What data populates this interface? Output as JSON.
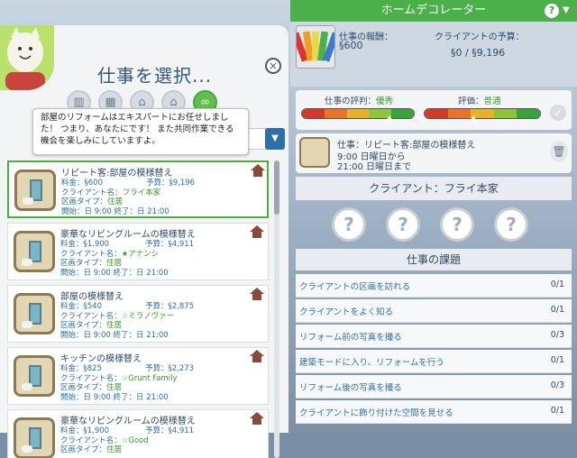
{
  "left": {
    "title": "仕事を選択...",
    "close": "×",
    "tooltip": "部屋のリフォームはエキスパートにお任せしました！ つまり、あなたにです！ また共同作業できる機会を楽しみにしていますよ。",
    "filters": [
      {
        "icon": "building-icon"
      },
      {
        "icon": "building-icon"
      },
      {
        "icon": "house-icon"
      },
      {
        "icon": "house-icon"
      },
      {
        "icon": "plumbob-icon",
        "active": true
      }
    ],
    "jobs": [
      {
        "title": "リピート客:部屋の模様替え",
        "fee": "料金：§600",
        "budget": "予算：§9,196",
        "client_label": "クライアント名：",
        "client": "フライ本家",
        "area_label": "区画タイプ：",
        "area": "住居",
        "time": "開始：日 9:00 終了：日 21:00",
        "selected": true
      },
      {
        "title": "豪華なリビングルームの模様替え",
        "fee": "料金：§1,900",
        "budget": "予算：§4,911",
        "client_label": "クライアント名：",
        "client": "★アナンシ",
        "area_label": "区画タイプ：",
        "area": "住居",
        "time": "開始：日 9:00 終了：日 21:00"
      },
      {
        "title": "部屋の模様替え",
        "fee": "料金：§540",
        "budget": "予算：§2,875",
        "client_label": "クライアント名：",
        "client": "☆ミラノヴァー",
        "area_label": "区画タイプ：",
        "area": "住居",
        "time": "開始：日 9:00 終了：日 21:00"
      },
      {
        "title": "キッチンの模様替え",
        "fee": "料金：§825",
        "budget": "予算：§2,273",
        "client_label": "クライアント名：",
        "client": "☆Grunt Family",
        "area_label": "区画タイプ：",
        "area": "住居",
        "time": "開始：日 9:00 終了：日 21:00"
      },
      {
        "title": "豪華なリビングルームの模様替え",
        "fee": "料金：§1,900",
        "budget": "予算：§4,911",
        "client_label": "クライアント名：",
        "client": "☆Good",
        "area_label": "区画タイプ：",
        "area": "住居",
        "time": ""
      }
    ]
  },
  "right": {
    "header": "ホームデコレーター",
    "help": "?",
    "pay_label": "仕事の報酬：",
    "pay_value": "§600",
    "budget_label": "クライアントの予算：",
    "budget_value": "§0 / §9,196",
    "rep_label": "仕事の評判：",
    "rep_value": "優秀",
    "eval_label": "評価：",
    "eval_value": "普通",
    "rep_level": 0.78,
    "eval_level": 0.42,
    "current_job_title": "仕事：リピート客:部屋の模様替え",
    "current_job_time1": "9:00 日曜日から",
    "current_job_time2": "21:00 日曜日まで",
    "client_heading": "クライアント：フライ本家",
    "tasks_heading": "仕事の課題",
    "tasks": [
      {
        "label": "クライアントの区画を訪れる",
        "count": "0/1"
      },
      {
        "label": "クライアントをよく知る",
        "count": "0/1"
      },
      {
        "label": "リフォーム前の写真を撮る",
        "count": "0/3"
      },
      {
        "label": "建築モードに入り、リフォームを行う",
        "count": "0/1"
      },
      {
        "label": "リフォーム後の写真を撮る",
        "count": "0/3"
      },
      {
        "label": "クライアントに飾り付けた空間を見せる",
        "count": "0/1"
      }
    ]
  },
  "colors": {
    "accent_green": "#4cb04a",
    "link_blue": "#2e6fa8",
    "title_blue": "#36577a"
  }
}
